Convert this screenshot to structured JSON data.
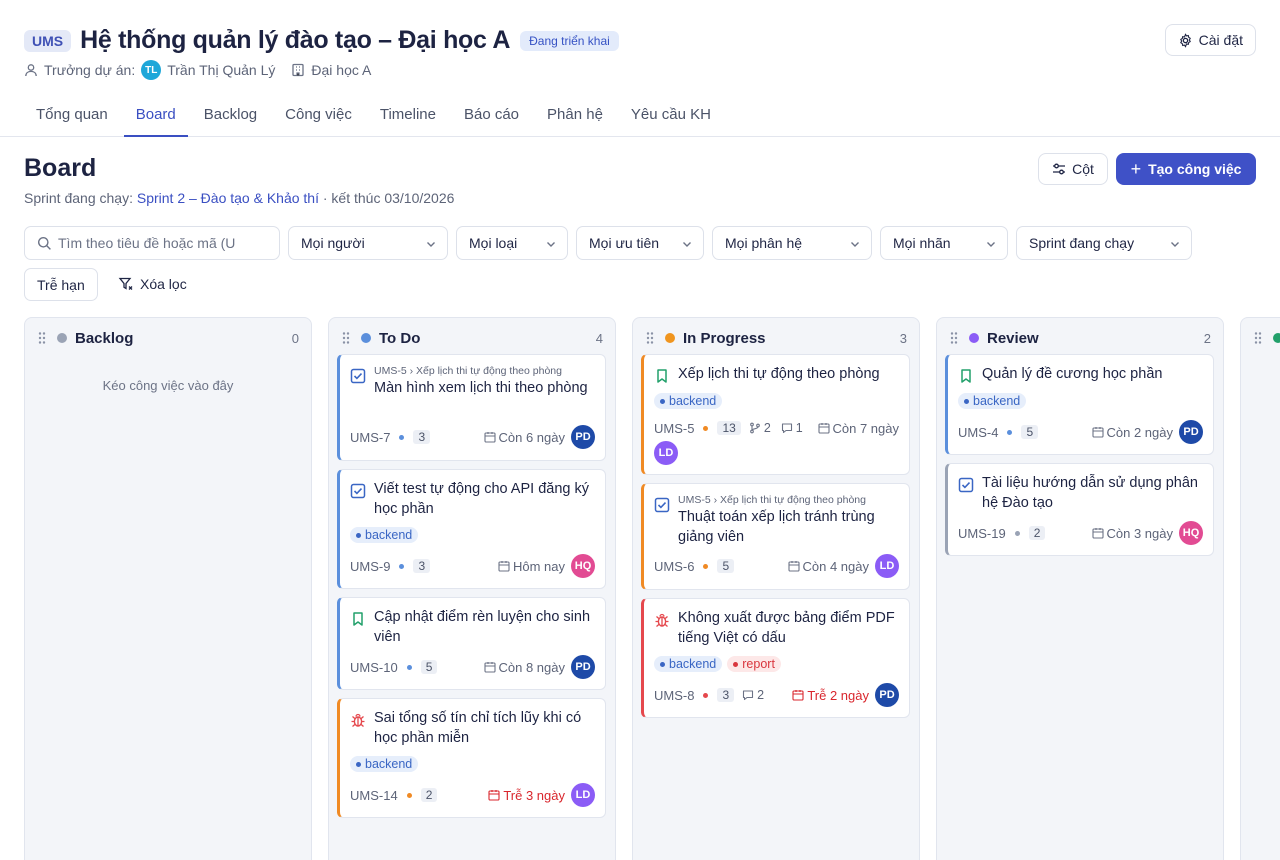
{
  "header": {
    "badge": "UMS",
    "title": "Hệ thống quản lý đào tạo – Đại học A",
    "status": "Đang triển khai",
    "lead_label": "Trưởng dự án:",
    "lead_initials": "TL",
    "lead_name": "Trần Thị Quản Lý",
    "org": "Đại học A",
    "settings_label": "Cài đặt"
  },
  "tabs": [
    "Tổng quan",
    "Board",
    "Backlog",
    "Công việc",
    "Timeline",
    "Báo cáo",
    "Phân hệ",
    "Yêu cầu KH"
  ],
  "board": {
    "title": "Board",
    "sprint_prefix": "Sprint đang chạy:",
    "sprint_name": "Sprint 2 – Đào tạo & Khảo thí",
    "sprint_suffix": "· kết thúc 03/10/2026",
    "columns_button": "Cột",
    "create_button": "Tạo công việc"
  },
  "filters": {
    "search_placeholder": "Tìm theo tiêu đề hoặc mã (U",
    "people": "Mọi người",
    "type": "Mọi loại",
    "priority": "Mọi ưu tiên",
    "module": "Mọi phân hệ",
    "label": "Mọi nhãn",
    "sprint": "Sprint đang chạy",
    "overdue": "Trễ hạn",
    "clear": "Xóa lọc"
  },
  "columns": [
    {
      "name": "Backlog",
      "count": "0",
      "color": "#9aa3b5",
      "empty_hint": "Kéo công việc vào đây"
    },
    {
      "name": "To Do",
      "count": "4",
      "color": "#5b8fdc"
    },
    {
      "name": "In Progress",
      "count": "3",
      "color": "#f0951f"
    },
    {
      "name": "Review",
      "count": "2",
      "color": "#8b5cf6"
    }
  ],
  "cards": {
    "todo": [
      {
        "parent": "UMS-5 › Xếp lịch thi tự động theo phòng",
        "title": "Màn hình xem lịch thi theo phòng",
        "key": "UMS-7",
        "points": "3",
        "due": "Còn 6 ngày",
        "assignee": "PD"
      },
      {
        "title": "Viết test tự động cho API đăng ký học phần",
        "tag": "backend",
        "key": "UMS-9",
        "points": "3",
        "due": "Hôm nay",
        "assignee": "HQ"
      },
      {
        "title": "Cập nhật điểm rèn luyện cho sinh viên",
        "key": "UMS-10",
        "points": "5",
        "due": "Còn 8 ngày",
        "assignee": "PD"
      },
      {
        "title": "Sai tổng số tín chỉ tích lũy khi có học phần miễn",
        "tag": "backend",
        "key": "UMS-14",
        "points": "2",
        "due": "Trễ 3 ngày",
        "assignee": "LD"
      }
    ],
    "inprogress": [
      {
        "title": "Xếp lịch thi tự động theo phòng",
        "tag": "backend",
        "key": "UMS-5",
        "points": "13",
        "subtasks": "2",
        "comments": "1",
        "due": "Còn 7 ngày",
        "assignee": "LD"
      },
      {
        "parent": "UMS-5 › Xếp lịch thi tự động theo phòng",
        "title": "Thuật toán xếp lịch tránh trùng giảng viên",
        "key": "UMS-6",
        "points": "5",
        "due": "Còn 4 ngày",
        "assignee": "LD"
      },
      {
        "title": "Không xuất được bảng điểm PDF tiếng Việt có dấu",
        "tag": "backend",
        "tag2": "report",
        "key": "UMS-8",
        "points": "3",
        "comments": "2",
        "due": "Trễ 2 ngày",
        "assignee": "PD"
      }
    ],
    "review": [
      {
        "title": "Quản lý đề cương học phần",
        "tag": "backend",
        "key": "UMS-4",
        "points": "5",
        "due": "Còn 2 ngày",
        "assignee": "PD"
      },
      {
        "title": "Tài liệu hướng dẫn sử dụng phân hệ Đào tạo",
        "key": "UMS-19",
        "points": "2",
        "due": "Còn 3 ngày",
        "assignee": "HQ"
      }
    ]
  },
  "colors": {
    "accent": "#3f51c7",
    "late": "#d9262d"
  }
}
